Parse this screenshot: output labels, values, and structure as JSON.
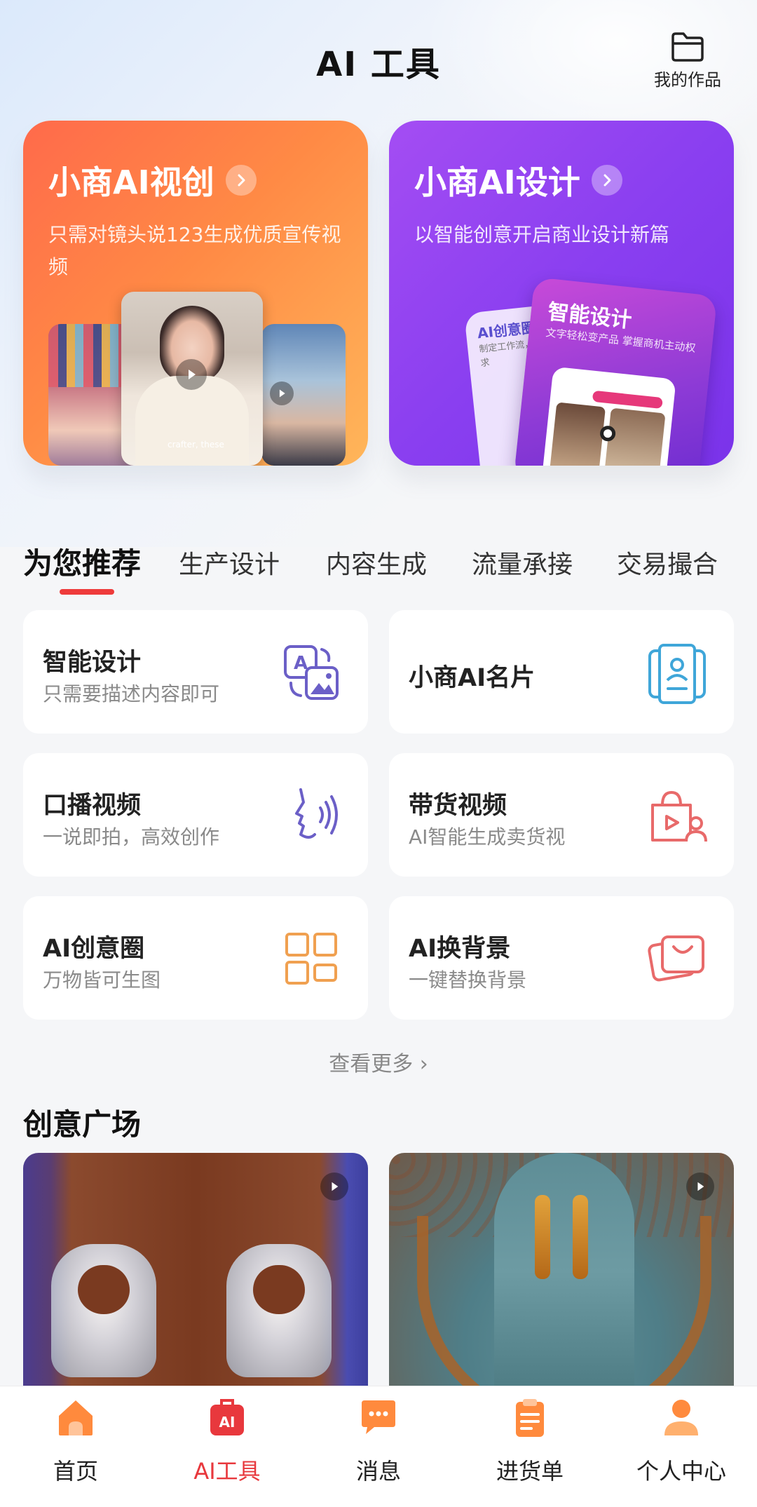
{
  "header": {
    "title": "AI 工具",
    "my_works_label": "我的作品",
    "my_works_icon": "folder-icon"
  },
  "hero_cards": [
    {
      "title": "小商AI视创",
      "subtitle": "只需对镜头说123生成优质宣传视频",
      "caption": "crafter, these"
    },
    {
      "title": "小商AI设计",
      "subtitle": "以智能创意开启商业设计新篇",
      "back_label": "AI创意圈",
      "back_sub": "制定工作流，满足电商场景创作需求",
      "front_label": "智能设计",
      "front_sub": "文字轻松变产品 掌握商机主动权"
    }
  ],
  "tabs": [
    {
      "label": "为您推荐",
      "active": true
    },
    {
      "label": "生产设计",
      "active": false
    },
    {
      "label": "内容生成",
      "active": false
    },
    {
      "label": "流量承接",
      "active": false
    },
    {
      "label": "交易撮合",
      "active": false
    }
  ],
  "tools": [
    {
      "name": "智能设计",
      "desc": "只需要描述内容即可",
      "icon": "translate-image-icon",
      "color": "#6b5fc7"
    },
    {
      "name": "小商AI名片",
      "desc": "",
      "icon": "business-card-icon",
      "color": "#3fa6d9"
    },
    {
      "name": "口播视频",
      "desc": "一说即拍，高效创作",
      "icon": "speaking-face-icon",
      "color": "#6b5fc7"
    },
    {
      "name": "带货视频",
      "desc": "AI智能生成卖货视",
      "icon": "shopping-bag-video-icon",
      "color": "#e86a6a"
    },
    {
      "name": "AI创意圈",
      "desc": "万物皆可生图",
      "icon": "grid-icon",
      "color": "#f0a050"
    },
    {
      "name": "AI换背景",
      "desc": "一键替换背景",
      "icon": "image-stack-icon",
      "color": "#e86a6a"
    }
  ],
  "see_more": "查看更多 ›",
  "section_title": "创意广场",
  "bottom_nav": [
    {
      "label": "首页",
      "icon": "home-icon",
      "active": false
    },
    {
      "label": "AI工具",
      "icon": "ai-toolbox-icon",
      "active": true
    },
    {
      "label": "消息",
      "icon": "message-icon",
      "active": false
    },
    {
      "label": "进货单",
      "icon": "clipboard-icon",
      "active": false
    },
    {
      "label": "个人中心",
      "icon": "person-icon",
      "active": false
    }
  ],
  "colors": {
    "accent": "#e8383d",
    "nav_orange": "#ff8a3d",
    "hero_left": "#ff6a4b",
    "hero_right": "#8a3ff0"
  }
}
